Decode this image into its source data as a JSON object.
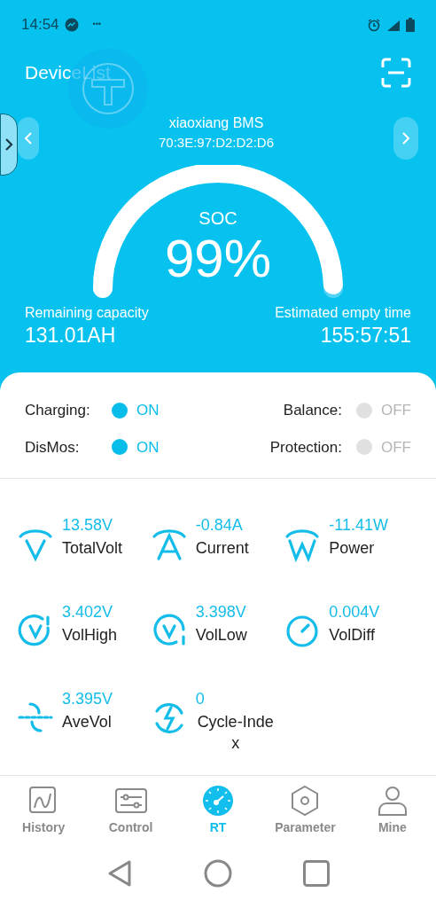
{
  "status_bar": {
    "time": "14:54",
    "more": "•••"
  },
  "header": {
    "title": "DeviceList"
  },
  "device": {
    "name": "xiaoxiang BMS",
    "mac": "70:3E:97:D2:D2:D6"
  },
  "gauge": {
    "label": "SOC",
    "value": "99%"
  },
  "remaining_capacity": {
    "label": "Remaining capacity",
    "value": "131.01AH"
  },
  "estimated_empty_time": {
    "label": "Estimated empty time",
    "value": "155:57:51"
  },
  "switches": [
    {
      "label": "Charging:",
      "state": "ON",
      "on": true
    },
    {
      "label": "Balance:",
      "state": "OFF",
      "on": false
    },
    {
      "label": "DisMos:",
      "state": "ON",
      "on": true
    },
    {
      "label": "Protection:",
      "state": "OFF",
      "on": false
    }
  ],
  "metrics": [
    {
      "kind": "volt",
      "value": "13.58V",
      "label": "TotalVolt"
    },
    {
      "kind": "amp",
      "value": "-0.84A",
      "label": "Current"
    },
    {
      "kind": "watt",
      "value": "-11.41W",
      "label": "Power"
    },
    {
      "kind": "high",
      "value": "3.402V",
      "label": "VolHigh"
    },
    {
      "kind": "low",
      "value": "3.398V",
      "label": "VolLow"
    },
    {
      "kind": "diff",
      "value": "0.004V",
      "label": "VolDiff"
    },
    {
      "kind": "ave",
      "value": "3.395V",
      "label": "AveVol"
    },
    {
      "kind": "cycle",
      "value": "0",
      "label": "Cycle-Index"
    }
  ],
  "nav": [
    {
      "kind": "history",
      "label": "History",
      "selected": false
    },
    {
      "kind": "control",
      "label": "Control",
      "selected": false
    },
    {
      "kind": "rt",
      "label": "RT",
      "selected": true
    },
    {
      "kind": "parameter",
      "label": "Parameter",
      "selected": false
    },
    {
      "kind": "mine",
      "label": "Mine",
      "selected": false
    }
  ]
}
